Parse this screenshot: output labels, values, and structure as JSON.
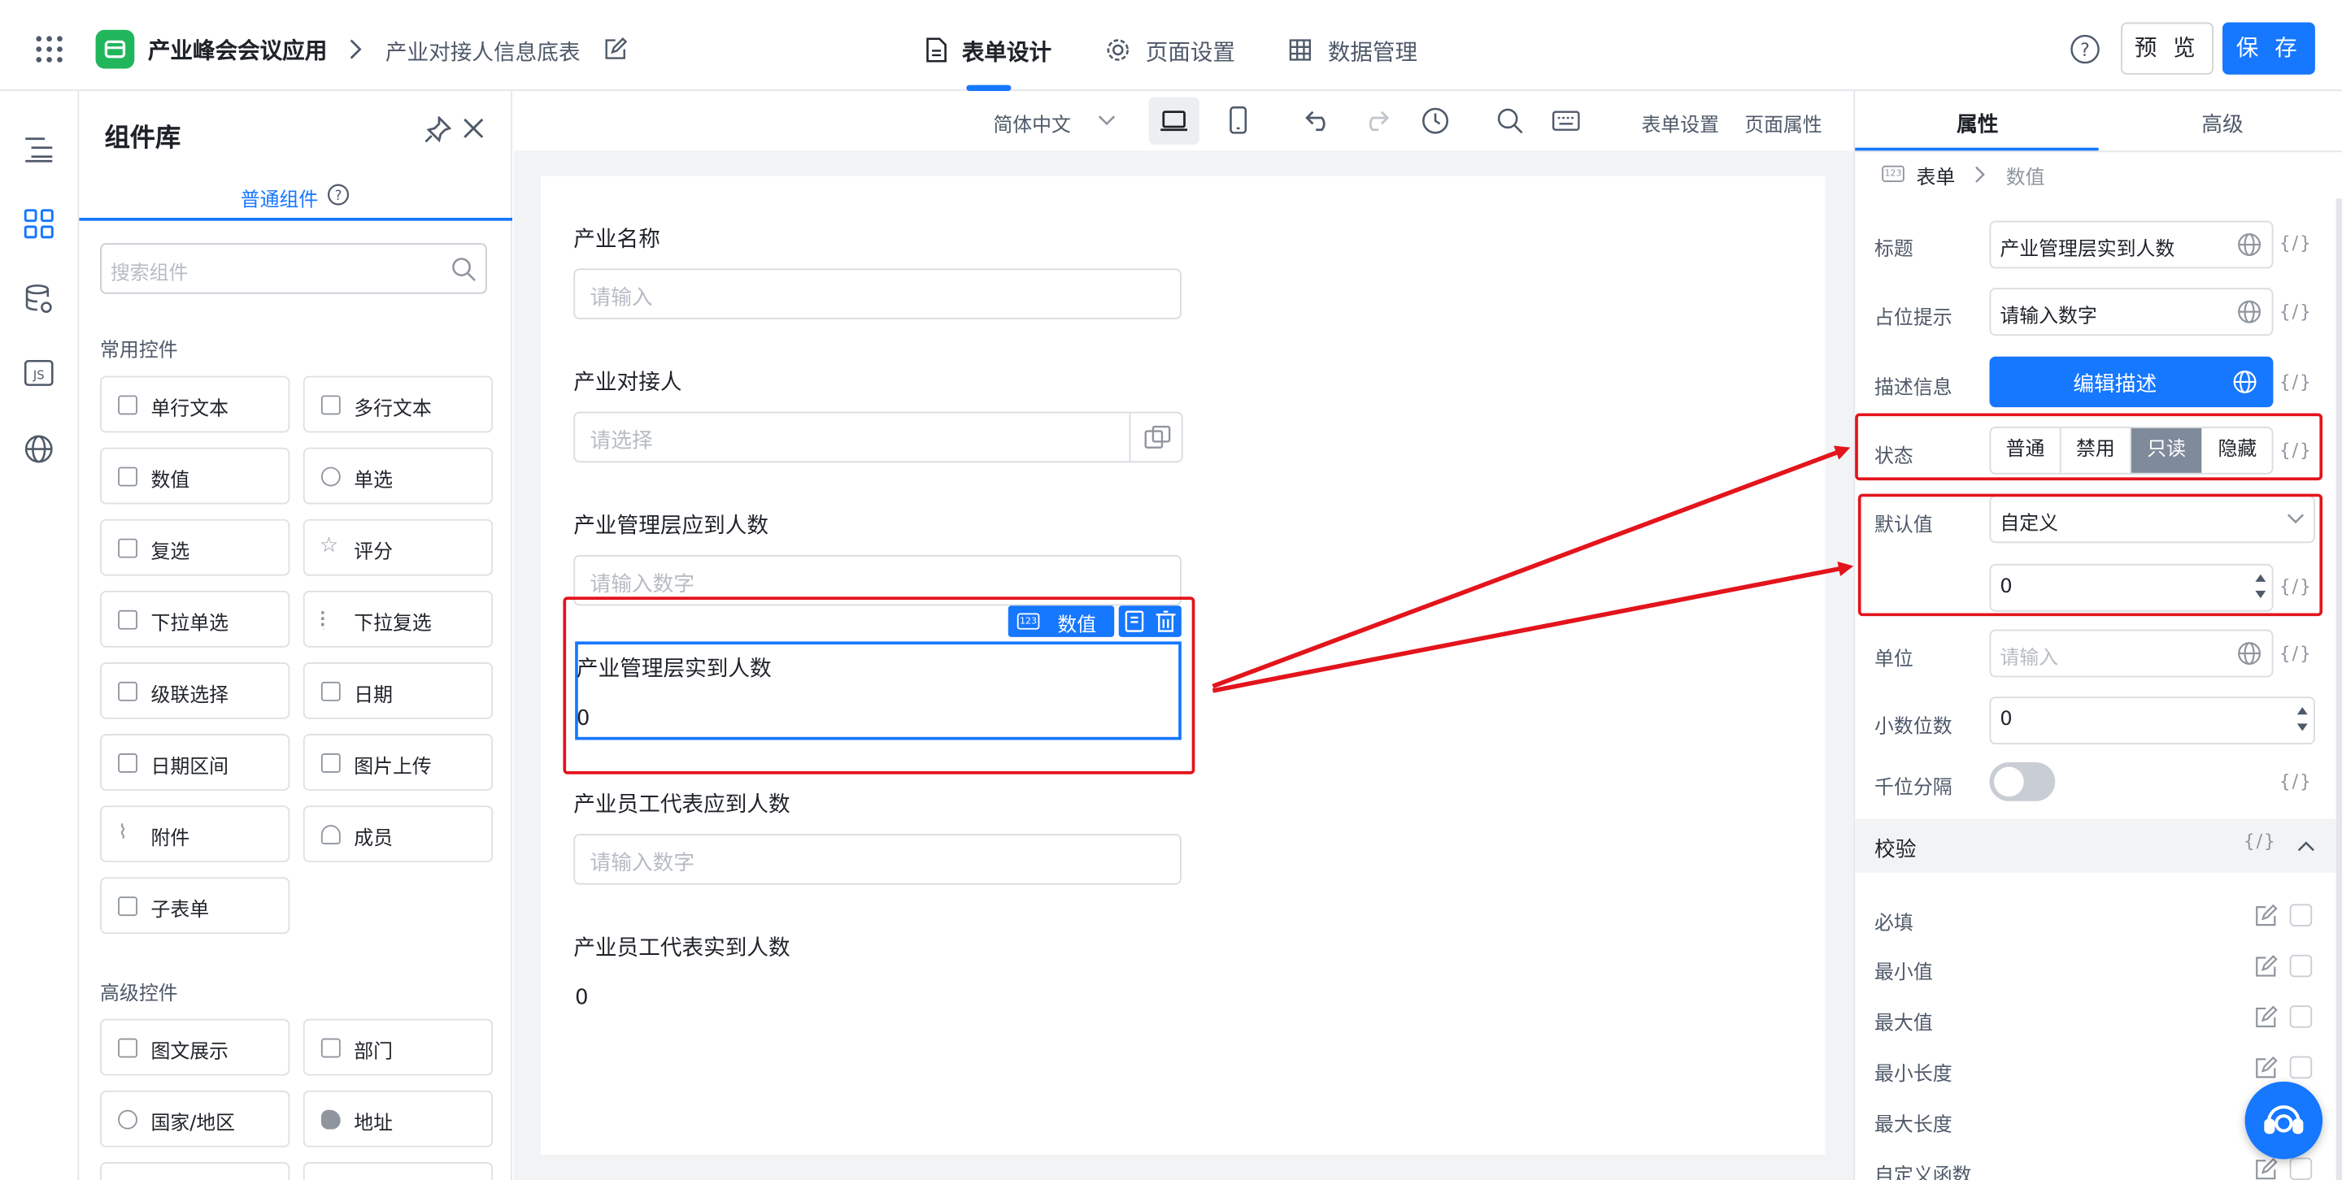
{
  "app": {
    "name": "产业峰会会议应用",
    "form_name": "产业对接人信息底表"
  },
  "tabs": [
    {
      "label": "表单设计"
    },
    {
      "label": "页面设置"
    },
    {
      "label": "数据管理"
    }
  ],
  "header": {
    "preview_label": "预 览",
    "save_label": "保 存"
  },
  "library": {
    "title": "组件库",
    "tab": "普通组件",
    "search_placeholder": "搜索组件",
    "common_section": "常用控件",
    "common_items": [
      {
        "label": "单行文本"
      },
      {
        "label": "多行文本"
      },
      {
        "label": "数值"
      },
      {
        "label": "单选"
      },
      {
        "label": "复选"
      },
      {
        "label": "评分"
      },
      {
        "label": "下拉单选"
      },
      {
        "label": "下拉复选"
      },
      {
        "label": "级联选择"
      },
      {
        "label": "日期"
      },
      {
        "label": "日期区间"
      },
      {
        "label": "图片上传"
      },
      {
        "label": "附件"
      },
      {
        "label": "成员"
      },
      {
        "label": "子表单"
      }
    ],
    "advanced_section": "高级控件",
    "advanced_items": [
      {
        "label": "图文展示"
      },
      {
        "label": "部门"
      },
      {
        "label": "国家/地区"
      },
      {
        "label": "地址"
      }
    ]
  },
  "toolbar": {
    "language": "简体中文",
    "form_settings": "表单设置",
    "page_props": "页面属性"
  },
  "form": {
    "fields": [
      {
        "label": "产业名称",
        "placeholder": "请输入"
      },
      {
        "label": "产业对接人",
        "placeholder": "请选择"
      },
      {
        "label": "产业管理层应到人数",
        "placeholder": "请输入数字"
      },
      {
        "label": "产业管理层实到人数",
        "value": "0"
      },
      {
        "label": "产业员工代表应到人数",
        "placeholder": "请输入数字"
      },
      {
        "label": "产业员工代表实到人数",
        "value": "0"
      }
    ],
    "selected_chip": "数值"
  },
  "props": {
    "tabs": [
      {
        "label": "属性"
      },
      {
        "label": "高级"
      }
    ],
    "breadcrumb": [
      "表单",
      "数值"
    ],
    "title_label": "标题",
    "title_value": "产业管理层实到人数",
    "placeholder_label": "占位提示",
    "placeholder_value": "请输入数字",
    "desc_label": "描述信息",
    "desc_button": "编辑描述",
    "state_label": "状态",
    "states": [
      "普通",
      "禁用",
      "只读",
      "隐藏"
    ],
    "state_selected": "只读",
    "default_label": "默认值",
    "default_mode": "自定义",
    "default_value": "0",
    "unit_label": "单位",
    "unit_placeholder": "请输入",
    "decimal_label": "小数位数",
    "decimal_value": "0",
    "thousand_label": "千位分隔",
    "validate_label": "校验",
    "rules": [
      "必填",
      "最小值",
      "最大值",
      "最小长度",
      "最大长度",
      "自定义函数"
    ],
    "fx": "{/}"
  },
  "colors": {
    "accent": "#1677ff",
    "annotation": "#e3141c",
    "selected_state": "#7f8a9a"
  }
}
